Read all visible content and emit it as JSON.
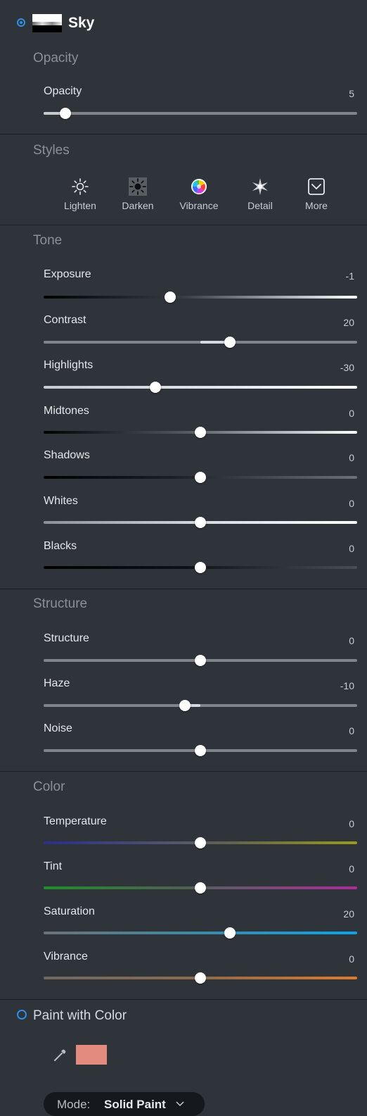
{
  "layer": {
    "title": "Sky"
  },
  "opacity_section": {
    "title": "Opacity",
    "sliders": [
      {
        "label": "Opacity",
        "value": "5",
        "position": 0.05
      }
    ]
  },
  "styles": {
    "title": "Styles",
    "items": [
      {
        "label": "Lighten",
        "icon": "sun-outline-icon"
      },
      {
        "label": "Darken",
        "icon": "sun-dark-icon"
      },
      {
        "label": "Vibrance",
        "icon": "color-wheel-icon"
      },
      {
        "label": "Detail",
        "icon": "sparkle-icon"
      },
      {
        "label": "More",
        "icon": "chevron-box-icon"
      }
    ]
  },
  "tone": {
    "title": "Tone",
    "sliders": [
      {
        "label": "Exposure",
        "value": "-1"
      },
      {
        "label": "Contrast",
        "value": "20"
      },
      {
        "label": "Highlights",
        "value": "-30"
      },
      {
        "label": "Midtones",
        "value": "0"
      },
      {
        "label": "Shadows",
        "value": "0"
      },
      {
        "label": "Whites",
        "value": "0"
      },
      {
        "label": "Blacks",
        "value": "0"
      }
    ]
  },
  "structure": {
    "title": "Structure",
    "sliders": [
      {
        "label": "Structure",
        "value": "0"
      },
      {
        "label": "Haze",
        "value": "-10"
      },
      {
        "label": "Noise",
        "value": "0"
      }
    ]
  },
  "color": {
    "title": "Color",
    "sliders": [
      {
        "label": "Temperature",
        "value": "0"
      },
      {
        "label": "Tint",
        "value": "0"
      },
      {
        "label": "Saturation",
        "value": "20"
      },
      {
        "label": "Vibrance",
        "value": "0"
      }
    ]
  },
  "paint": {
    "title": "Paint with Color",
    "swatch_color": "#e28b7e",
    "mode_label": "Mode:",
    "mode_value": "Solid Paint"
  },
  "colors": {
    "accent": "#2f8de4",
    "panel": "#2f343b"
  }
}
